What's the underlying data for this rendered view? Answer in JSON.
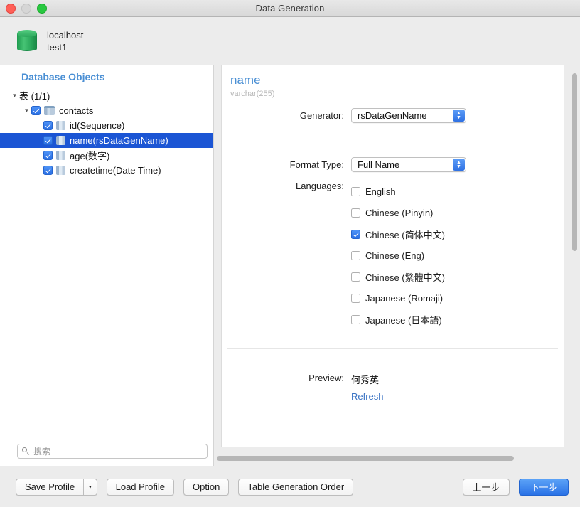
{
  "window": {
    "title": "Data Generation",
    "traffic_lights": [
      "close-button",
      "minimize-button",
      "maximize-button"
    ]
  },
  "header": {
    "icon": "database-icon",
    "host": "localhost",
    "database": "test1"
  },
  "sidebar": {
    "title": "Database Objects",
    "tree": [
      {
        "label": "表 (1/1)",
        "depth": 0,
        "twisty": "▼",
        "checkbox": null,
        "icon": null,
        "selected": false
      },
      {
        "label": "contacts",
        "depth": 1,
        "twisty": "▼",
        "checkbox": "checked",
        "icon": "table-icon",
        "selected": false
      },
      {
        "label": "id(Sequence)",
        "depth": 2,
        "twisty": "",
        "checkbox": "checked",
        "icon": "column-icon",
        "selected": false
      },
      {
        "label": "name(rsDataGenName)",
        "depth": 2,
        "twisty": "",
        "checkbox": "checked",
        "icon": "column-icon",
        "selected": true
      },
      {
        "label": "age(数字)",
        "depth": 2,
        "twisty": "",
        "checkbox": "checked",
        "icon": "column-icon",
        "selected": false
      },
      {
        "label": "createtime(Date Time)",
        "depth": 2,
        "twisty": "",
        "checkbox": "checked",
        "icon": "column-icon",
        "selected": false
      }
    ],
    "search": {
      "placeholder": "搜索",
      "value": "",
      "icon": "search-icon"
    }
  },
  "main": {
    "column_name": "name",
    "column_type": "varchar(255)",
    "generator": {
      "label": "Generator:",
      "value": "rsDataGenName"
    },
    "format_type": {
      "label": "Format Type:",
      "value": "Full Name"
    },
    "languages": {
      "label": "Languages:",
      "options": [
        {
          "label": "English",
          "checked": false
        },
        {
          "label": "Chinese (Pinyin)",
          "checked": false
        },
        {
          "label": "Chinese (简体中文)",
          "checked": true
        },
        {
          "label": "Chinese (Eng)",
          "checked": false
        },
        {
          "label": "Chinese (繁體中文)",
          "checked": false
        },
        {
          "label": "Japanese (Romaji)",
          "checked": false
        },
        {
          "label": "Japanese (日本語)",
          "checked": false
        }
      ]
    },
    "preview": {
      "label": "Preview:",
      "value": "何秀英",
      "refresh_label": "Refresh"
    }
  },
  "footer": {
    "save_profile": "Save Profile",
    "save_profile_arrow": "▾",
    "load_profile": "Load Profile",
    "option": "Option",
    "table_generation_order": "Table Generation Order",
    "previous": "上一步",
    "next": "下一步"
  },
  "colors": {
    "accent": "#4a8fd4",
    "selection": "#1b55d4",
    "primary_button": "#2a72e6",
    "link": "#3a73c4",
    "db_icon": "#2da75c"
  }
}
